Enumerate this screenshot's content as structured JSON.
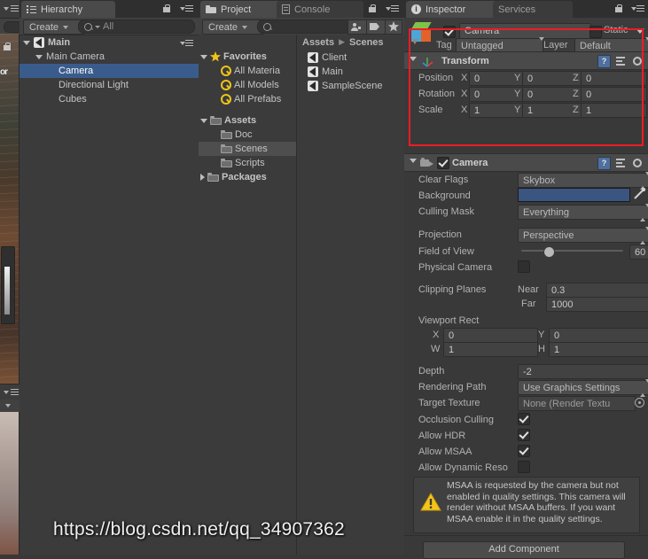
{
  "scene_panel": {
    "lock_icon": "lock-icon",
    "menu_icon": "hamburger-menu-icon",
    "cut_label": "or"
  },
  "hierarchy": {
    "tab_label": "Hierarchy",
    "tab_icon": "hierarchy-list-icon",
    "lock_icon": "lock-icon",
    "menu_icon": "hamburger-menu-icon",
    "create_label": "Create",
    "search_placeholder": "All",
    "search_icon": "search-icon",
    "items": [
      {
        "label": "Main",
        "icon": "unity-scene-icon",
        "depth": 0,
        "arrow": "down",
        "selected": false,
        "bold": true
      },
      {
        "label": "Main Camera",
        "icon": "",
        "depth": 1,
        "arrow": "down",
        "selected": false,
        "bold": false
      },
      {
        "label": "Camera",
        "icon": "",
        "depth": 2,
        "arrow": "none",
        "selected": true,
        "bold": false
      },
      {
        "label": "Directional Light",
        "icon": "",
        "depth": 2,
        "arrow": "none",
        "selected": false,
        "bold": false
      },
      {
        "label": "Cubes",
        "icon": "",
        "depth": 2,
        "arrow": "none",
        "selected": false,
        "bold": false
      }
    ]
  },
  "project": {
    "tabs": [
      {
        "label": "Project",
        "icon": "folder-icon",
        "active": true
      },
      {
        "label": "Console",
        "icon": "console-icon",
        "active": false
      }
    ],
    "lock_icon": "lock-icon",
    "menu_icon": "hamburger-menu-icon",
    "create_label": "Create",
    "search_placeholder": "",
    "search_icon": "search-icon",
    "toolbar_icons": [
      "avatar-filter-icon",
      "label-tag-icon",
      "favorite-star-icon"
    ],
    "tree": [
      {
        "label": "Favorites",
        "icon": "star-icon",
        "depth": 0,
        "arrow": "down",
        "selected": false,
        "bold": true
      },
      {
        "label": "All Materia",
        "icon": "search-icon",
        "depth": 1,
        "arrow": "none",
        "selected": false,
        "bold": false
      },
      {
        "label": "All Models",
        "icon": "search-icon",
        "depth": 1,
        "arrow": "none",
        "selected": false,
        "bold": false
      },
      {
        "label": "All Prefabs",
        "icon": "search-icon",
        "depth": 1,
        "arrow": "none",
        "selected": false,
        "bold": false
      },
      {
        "label": "Assets",
        "icon": "folder-icon",
        "depth": 0,
        "arrow": "down",
        "selected": false,
        "bold": true
      },
      {
        "label": "Doc",
        "icon": "folder-icon",
        "depth": 1,
        "arrow": "none",
        "selected": false,
        "bold": false
      },
      {
        "label": "Scenes",
        "icon": "folder-icon",
        "depth": 1,
        "arrow": "none",
        "selected": true,
        "bold": false
      },
      {
        "label": "Scripts",
        "icon": "folder-icon",
        "depth": 1,
        "arrow": "none",
        "selected": false,
        "bold": false
      },
      {
        "label": "Packages",
        "icon": "folder-icon",
        "depth": 0,
        "arrow": "right",
        "selected": false,
        "bold": true
      }
    ],
    "breadcrumb": {
      "root": "Assets",
      "leaf": "Scenes"
    },
    "contents": [
      {
        "label": "Client",
        "icon": "unity-scene-icon"
      },
      {
        "label": "Main",
        "icon": "unity-scene-icon"
      },
      {
        "label": "SampleScene",
        "icon": "unity-scene-icon"
      }
    ]
  },
  "inspector": {
    "tabs": [
      {
        "label": "Inspector",
        "icon": "info-icon",
        "active": true
      },
      {
        "label": "Services",
        "icon": "",
        "active": false
      }
    ],
    "lock_icon": "lock-icon",
    "menu_icon": "hamburger-menu-icon",
    "gameobject": {
      "icon": "gameobject-cube-icon",
      "enabled": true,
      "name": "Camera",
      "static_label": "Static",
      "static_checked": false,
      "static_dropdown_icon": "chevron-down-icon",
      "tag_label": "Tag",
      "tag_value": "Untagged",
      "layer_label": "Layer",
      "layer_value": "Default"
    },
    "transform": {
      "title": "Transform",
      "icon": "transform-axis-icon",
      "help_icon": "help-icon",
      "preset_icon": "preset-icon",
      "gear_icon": "gear-icon",
      "rows": [
        {
          "label": "Position",
          "x": "0",
          "y": "0",
          "z": "0"
        },
        {
          "label": "Rotation",
          "x": "0",
          "y": "0",
          "z": "0"
        },
        {
          "label": "Scale",
          "x": "1",
          "y": "1",
          "z": "1"
        }
      ],
      "axis_labels": [
        "X",
        "Y",
        "Z"
      ]
    },
    "camera": {
      "title": "Camera",
      "enabled": true,
      "icon": "camera-icon",
      "help_icon": "help-icon",
      "preset_icon": "preset-icon",
      "gear_icon": "gear-icon",
      "clear_flags_label": "Clear Flags",
      "clear_flags_value": "Skybox",
      "background_label": "Background",
      "background_color": "#3a5580",
      "eyedropper_icon": "eyedropper-icon",
      "culling_mask_label": "Culling Mask",
      "culling_mask_value": "Everything",
      "projection_label": "Projection",
      "projection_value": "Perspective",
      "fov_label": "Field of View",
      "fov_value": "60",
      "fov_slider_pct": 26,
      "physical_camera_label": "Physical Camera",
      "physical_camera_checked": false,
      "clipping_planes_label": "Clipping Planes",
      "near_label": "Near",
      "near_value": "0.3",
      "far_label": "Far",
      "far_value": "1000",
      "viewport_rect_label": "Viewport Rect",
      "viewport": {
        "x_label": "X",
        "x": "0",
        "y_label": "Y",
        "y": "0",
        "w_label": "W",
        "w": "1",
        "h_label": "H",
        "h": "1"
      },
      "depth_label": "Depth",
      "depth_value": "-2",
      "rendering_path_label": "Rendering Path",
      "rendering_path_value": "Use Graphics Settings",
      "target_texture_label": "Target Texture",
      "target_texture_value": "None (Render Textu",
      "target_texture_picker_icon": "object-picker-icon",
      "occlusion_culling_label": "Occlusion Culling",
      "occlusion_culling_checked": true,
      "allow_hdr_label": "Allow HDR",
      "allow_hdr_checked": true,
      "allow_msaa_label": "Allow MSAA",
      "allow_msaa_checked": true,
      "allow_dynamic_res_label": "Allow Dynamic Reso",
      "allow_dynamic_res_checked": false
    },
    "warning": {
      "icon": "warning-triangle-icon",
      "message": "MSAA is requested by the camera but not enabled in quality settings. This camera will render without MSAA buffers. If you want MSAA enable it in the quality settings."
    },
    "add_component_label": "Add Component"
  },
  "annotation": {
    "color": "#ee1c25",
    "name": "red-highlight-rectangle"
  },
  "watermark": {
    "text": "https://blog.csdn.net/qq_34907362"
  }
}
